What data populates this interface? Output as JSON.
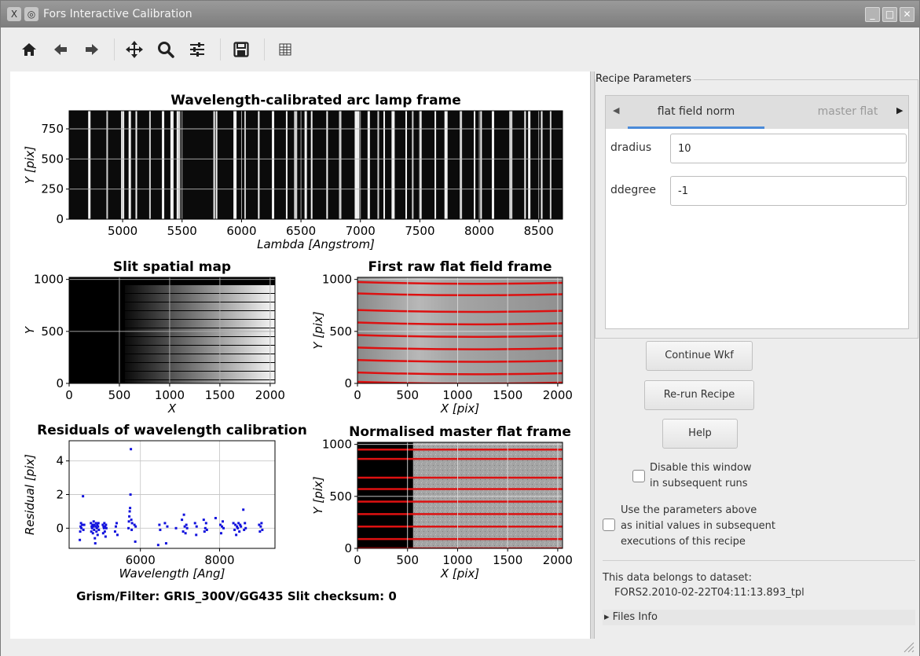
{
  "window": {
    "title": "Fors Interactive Calibration",
    "controls": {
      "minimize": "_",
      "maximize": "□",
      "close": "✕"
    }
  },
  "toolbar": {
    "tools": [
      "home-icon",
      "back-icon",
      "forward-icon",
      "pan-icon",
      "zoom-icon",
      "subplots-icon",
      "save-icon",
      "grid-icon"
    ]
  },
  "figure": {
    "footer": "Grism/Filter: GRIS_300V/GG435 Slit checksum: 0",
    "plots": {
      "arc": {
        "title": "Wavelength-calibrated arc lamp frame",
        "xlabel": "Lambda [Angstrom]",
        "ylabel": "Y [pix]",
        "xticks": [
          "5000",
          "5500",
          "6000",
          "6500",
          "7000",
          "7500",
          "8000",
          "8500"
        ],
        "yticks": [
          "750",
          "500",
          "250",
          "0"
        ]
      },
      "slit": {
        "title": "Slit spatial map",
        "xlabel": "X",
        "ylabel": "Y",
        "xticks": [
          "0",
          "500",
          "1000",
          "1500",
          "2000"
        ],
        "yticks": [
          "1000",
          "500",
          "0"
        ]
      },
      "rawflat": {
        "title": "First raw flat field frame",
        "xlabel": "X [pix]",
        "ylabel": "Y [pix]",
        "xticks": [
          "0",
          "500",
          "1000",
          "1500",
          "2000"
        ],
        "yticks": [
          "1000",
          "500",
          "0"
        ]
      },
      "resid": {
        "title": "Residuals of wavelength calibration",
        "xlabel": "Wavelength [Ang]",
        "ylabel": "Residual [pix]",
        "xticks": [
          "6000",
          "8000"
        ],
        "yticks": [
          "4",
          "2",
          "0"
        ]
      },
      "normflat": {
        "title": "Normalised master flat frame",
        "xlabel": "X [pix]",
        "ylabel": "Y [pix]",
        "xticks": [
          "0",
          "500",
          "1000",
          "1500",
          "2000"
        ],
        "yticks": [
          "1000",
          "500",
          "0"
        ]
      }
    }
  },
  "chart_data": [
    {
      "type": "heatmap",
      "title": "Wavelength-calibrated arc lamp frame",
      "xlabel": "Lambda [Angstrom]",
      "ylabel": "Y [pix]",
      "xlim": [
        4550,
        8700
      ],
      "ylim": [
        0,
        900
      ],
      "grid": true,
      "arc_line_wavelengths": [
        4720,
        4870,
        5000,
        5060,
        5115,
        5230,
        5340,
        5415,
        5461,
        5475,
        5770,
        5790,
        5945,
        6030,
        6145,
        6265,
        6380,
        6455,
        6540,
        6590,
        6720,
        6830,
        6965,
        6985,
        7070,
        7150,
        7200,
        7275,
        7385,
        7440,
        7505,
        7630,
        7720,
        7845,
        7960,
        8015,
        8115,
        8265,
        8385,
        8420,
        8525,
        8600
      ]
    },
    {
      "type": "heatmap",
      "title": "Slit spatial map",
      "xlabel": "X",
      "ylabel": "Y",
      "xlim": [
        0,
        2048
      ],
      "ylim": [
        0,
        1020
      ],
      "grid": true,
      "illuminated_x_start": 555
    },
    {
      "type": "heatmap",
      "title": "First raw flat field frame",
      "xlabel": "X [pix]",
      "ylabel": "Y [pix]",
      "xlim": [
        0,
        2048
      ],
      "ylim": [
        0,
        1020
      ],
      "grid": true,
      "slit_trace_y": [
        960,
        850,
        690,
        570,
        450,
        330,
        210,
        90,
        0
      ],
      "trace_color": "#dd1111"
    },
    {
      "type": "scatter",
      "title": "Residuals of wavelength calibration",
      "xlabel": "Wavelength [Ang]",
      "ylabel": "Residual [pix]",
      "xlim": [
        4200,
        9400
      ],
      "ylim": [
        -1.2,
        5.2
      ],
      "grid": true,
      "color": "#1111dd",
      "series": [
        {
          "x": [
            4470,
            4480,
            4490,
            4500,
            4510,
            4530,
            4550,
            4560,
            4580,
            4750,
            4760,
            4770,
            4780,
            4790,
            4800,
            4810,
            4820,
            4830,
            4840,
            4850,
            4860,
            4870,
            4880,
            4890,
            4900,
            4910,
            4920,
            4930,
            4940,
            4950,
            5050,
            5060,
            5070,
            5080,
            5090,
            5100,
            5110,
            5120,
            5130,
            5140,
            5360,
            5380,
            5400,
            5420,
            5700,
            5710,
            5720,
            5730,
            5740,
            5750,
            5760,
            5770,
            5780,
            5790,
            5850,
            5870,
            5880,
            6450,
            6480,
            6500,
            6620,
            6650,
            6680,
            6900,
            7050,
            7080,
            7100,
            7120,
            7140,
            7160,
            7180,
            7380,
            7410,
            7420,
            7600,
            7620,
            7640,
            7660,
            7680,
            7900,
            8020,
            8040,
            8060,
            8080,
            8100,
            8350,
            8380,
            8400,
            8420,
            8440,
            8460,
            8480,
            8500,
            8520,
            8540,
            8600,
            8620,
            8640,
            8660,
            9000,
            9020,
            9040,
            9060,
            9080
          ],
          "y": [
            -0.7,
            -0.2,
            0.1,
            0.3,
            0.0,
            0.2,
            1.9,
            -0.1,
            0.2,
            0.3,
            -0.2,
            0.1,
            0.0,
            0.2,
            -0.3,
            0.1,
            0.4,
            -0.1,
            0.2,
            -0.6,
            -0.9,
            0.1,
            0.3,
            -0.2,
            0.0,
            0.2,
            -0.4,
            0.1,
            0.3,
            -0.1,
            0.2,
            -0.3,
            0.1,
            0.0,
            0.3,
            -0.2,
            0.1,
            -0.5,
            0.2,
            0.0,
            -0.2,
            0.1,
            0.3,
            -0.4,
            0.0,
            0.4,
            0.7,
            1.0,
            1.2,
            2.0,
            4.7,
            0.5,
            -0.1,
            0.3,
            0.2,
            -0.8,
            0.1,
            -1.0,
            0.2,
            -0.1,
            0.3,
            -0.9,
            0.1,
            0.0,
            0.5,
            -0.2,
            0.8,
            0.1,
            -0.3,
            0.2,
            0.0,
            0.3,
            -0.4,
            0.1,
            0.5,
            -0.2,
            0.0,
            0.3,
            -0.1,
            0.6,
            0.2,
            -0.3,
            0.1,
            0.4,
            0.0,
            0.3,
            -0.1,
            0.2,
            -0.4,
            0.1,
            0.0,
            0.3,
            -0.2,
            0.2,
            0.1,
            1.1,
            -0.1,
            0.3,
            0.0,
            0.2,
            -0.2,
            0.1,
            0.3,
            -0.1
          ]
        }
      ]
    },
    {
      "type": "heatmap",
      "title": "Normalised master flat frame",
      "xlabel": "X [pix]",
      "ylabel": "Y [pix]",
      "xlim": [
        0,
        2048
      ],
      "ylim": [
        0,
        1020
      ],
      "grid": true,
      "illuminated_x_start": 555,
      "slit_trace_y": [
        950,
        860,
        680,
        570,
        450,
        330,
        210,
        90,
        0
      ],
      "trace_color": "#dd1111"
    }
  ],
  "panel": {
    "group_title": "Recipe Parameters",
    "tabs": {
      "active": "flat field norm",
      "inactive": "master flat"
    },
    "params": [
      {
        "label": "dradius",
        "value": "10"
      },
      {
        "label": "ddegree",
        "value": "-1"
      }
    ],
    "buttons": {
      "continue": "Continue Wkf",
      "rerun": "Re-run Recipe",
      "help": "Help"
    },
    "disable_window": {
      "line1": "Disable this window",
      "line2": "in subsequent runs",
      "checked": false
    },
    "use_params": {
      "line1": "Use the parameters above",
      "line2": "as initial values in subsequent",
      "line3": "executions of this recipe",
      "checked": false
    },
    "dataset_label": "This data belongs to dataset:",
    "dataset_value": "FORS2.2010-02-22T04:11:13.893_tpl",
    "files_info": "Files Info"
  },
  "colors": {
    "accent": "#4a8ad8",
    "trace": "#dd1111",
    "residual": "#1111dd"
  }
}
